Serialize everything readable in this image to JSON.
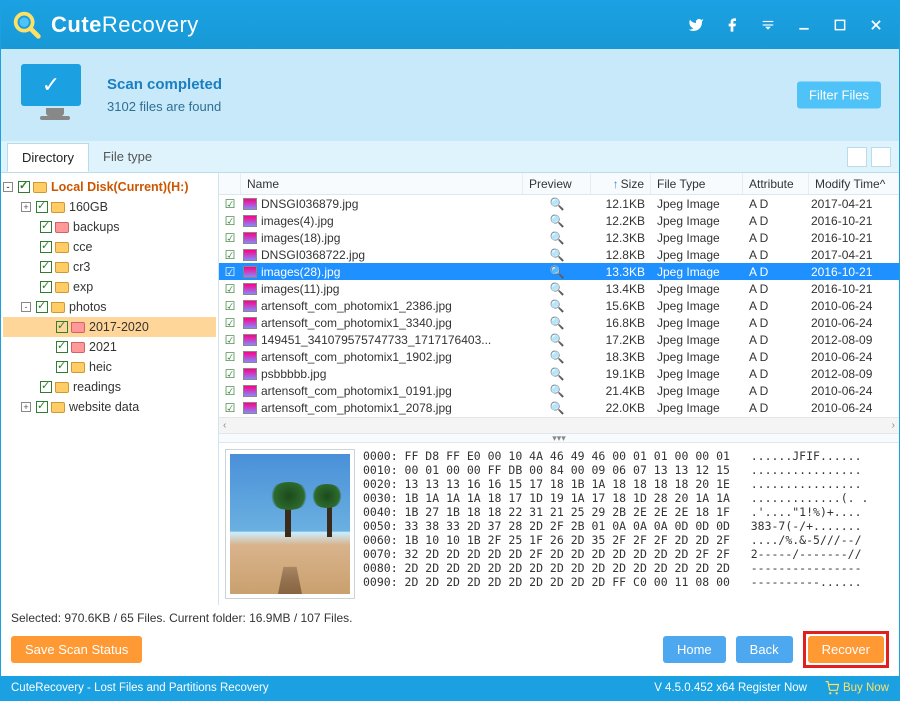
{
  "app": {
    "title_bold": "Cute",
    "title_light": "Recovery"
  },
  "status": {
    "title": "Scan completed",
    "subtitle": "3102 files are found",
    "filter_btn": "Filter Files"
  },
  "tabs": {
    "directory": "Directory",
    "filetype": "File type"
  },
  "tree": {
    "root": "Local Disk(Current)(H:)",
    "items": [
      "160GB",
      "backups",
      "cce",
      "cr3",
      "exp",
      "photos",
      "readings",
      "website data"
    ],
    "photos_children": [
      "2017-2020",
      "2021",
      "heic"
    ]
  },
  "columns": {
    "name": "Name",
    "preview": "Preview",
    "size": "Size",
    "type": "File Type",
    "attr": "Attribute",
    "date": "Modify Time"
  },
  "files": [
    {
      "name": "DNSGI036879.jpg",
      "size": "12.1KB",
      "type": "Jpeg Image",
      "attr": "A D",
      "date": "2017-04-21",
      "sel": false
    },
    {
      "name": "images(4).jpg",
      "size": "12.2KB",
      "type": "Jpeg Image",
      "attr": "A D",
      "date": "2016-10-21",
      "sel": false
    },
    {
      "name": "images(18).jpg",
      "size": "12.3KB",
      "type": "Jpeg Image",
      "attr": "A D",
      "date": "2016-10-21",
      "sel": false
    },
    {
      "name": "DNSGI0368722.jpg",
      "size": "12.8KB",
      "type": "Jpeg Image",
      "attr": "A D",
      "date": "2017-04-21",
      "sel": false
    },
    {
      "name": "images(28).jpg",
      "size": "13.3KB",
      "type": "Jpeg Image",
      "attr": "A D",
      "date": "2016-10-21",
      "sel": true
    },
    {
      "name": "images(11).jpg",
      "size": "13.4KB",
      "type": "Jpeg Image",
      "attr": "A D",
      "date": "2016-10-21",
      "sel": false
    },
    {
      "name": "artensoft_com_photomix1_2386.jpg",
      "size": "15.6KB",
      "type": "Jpeg Image",
      "attr": "A D",
      "date": "2010-06-24",
      "sel": false
    },
    {
      "name": "artensoft_com_photomix1_3340.jpg",
      "size": "16.8KB",
      "type": "Jpeg Image",
      "attr": "A D",
      "date": "2010-06-24",
      "sel": false
    },
    {
      "name": "149451_341079575747733_1717176403...",
      "size": "17.2KB",
      "type": "Jpeg Image",
      "attr": "A D",
      "date": "2012-08-09",
      "sel": false
    },
    {
      "name": "artensoft_com_photomix1_1902.jpg",
      "size": "18.3KB",
      "type": "Jpeg Image",
      "attr": "A D",
      "date": "2010-06-24",
      "sel": false
    },
    {
      "name": "psbbbbb.jpg",
      "size": "19.1KB",
      "type": "Jpeg Image",
      "attr": "A D",
      "date": "2012-08-09",
      "sel": false
    },
    {
      "name": "artensoft_com_photomix1_0191.jpg",
      "size": "21.4KB",
      "type": "Jpeg Image",
      "attr": "A D",
      "date": "2010-06-24",
      "sel": false
    },
    {
      "name": "artensoft_com_photomix1_2078.jpg",
      "size": "22.0KB",
      "type": "Jpeg Image",
      "attr": "A D",
      "date": "2010-06-24",
      "sel": false
    }
  ],
  "hex": [
    "0000: FF D8 FF E0 00 10 4A 46 49 46 00 01 01 00 00 01   ......JFIF......",
    "0010: 00 01 00 00 FF DB 00 84 00 09 06 07 13 13 12 15   ................",
    "0020: 13 13 13 16 16 15 17 18 1B 1A 18 18 18 18 20 1E   ................",
    "0030: 1B 1A 1A 1A 18 17 1D 19 1A 17 18 1D 28 20 1A 1A   .............(. .",
    "0040: 1B 27 1B 18 18 22 31 21 25 29 2B 2E 2E 2E 18 1F   .'....\"1!%)+....",
    "0050: 33 38 33 2D 37 28 2D 2F 2B 01 0A 0A 0A 0D 0D 0D   383-7(-/+.......",
    "0060: 1B 10 10 1B 2F 25 1F 26 2D 35 2F 2F 2F 2D 2D 2F   ..../%.&-5///--/",
    "0070: 32 2D 2D 2D 2D 2D 2F 2D 2D 2D 2D 2D 2D 2D 2F 2F   2-----/-------//",
    "0080: 2D 2D 2D 2D 2D 2D 2D 2D 2D 2D 2D 2D 2D 2D 2D 2D   ----------------",
    "0090: 2D 2D 2D 2D 2D 2D 2D 2D 2D 2D FF C0 00 11 08 00   ----------......"
  ],
  "info": {
    "selected": "Selected: 970.6KB / 65 Files.  Current folder: 16.9MB / 107 Files."
  },
  "buttons": {
    "save": "Save Scan Status",
    "home": "Home",
    "back": "Back",
    "recover": "Recover"
  },
  "footer": {
    "left": "CuteRecovery - Lost Files and Partitions Recovery",
    "version": "V 4.5.0.452 x64  Register Now",
    "buy": "Buy Now"
  }
}
